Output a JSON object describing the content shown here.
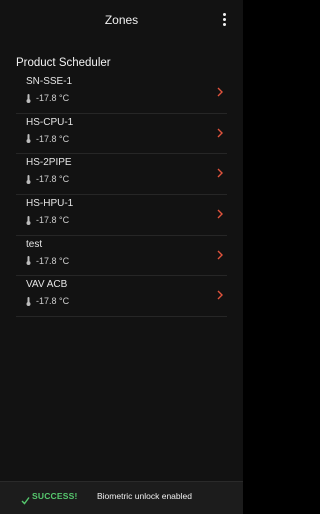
{
  "header": {
    "title": "Zones",
    "menu_icon": "more-vertical-icon"
  },
  "section": {
    "title": "Product Scheduler"
  },
  "zones": [
    {
      "name": "SN-SSE-1",
      "temperature": "-17.8 °C"
    },
    {
      "name": "HS-CPU-1",
      "temperature": "-17.8 °C"
    },
    {
      "name": "HS-2PIPE",
      "temperature": "-17.8 °C"
    },
    {
      "name": "HS-HPU-1",
      "temperature": "-17.8 °C"
    },
    {
      "name": "test",
      "temperature": "-17.8 °C"
    },
    {
      "name": "VAV ACB",
      "temperature": "-17.8 °C"
    }
  ],
  "snackbar": {
    "status": "SUCCESS!",
    "message": "Biometric unlock enabled",
    "status_icon": "check-icon"
  },
  "colors": {
    "background": "#121212",
    "chevron": "#e0533d",
    "success": "#56c86e"
  }
}
